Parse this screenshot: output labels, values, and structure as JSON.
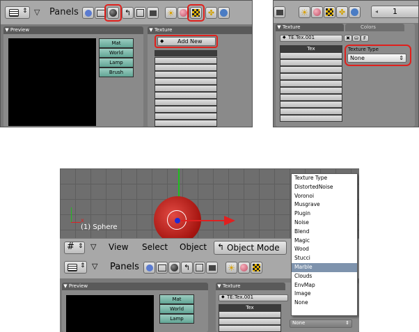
{
  "top_left": {
    "header": {
      "panels_label": "Panels"
    },
    "preview_title": "Preview",
    "texture_title": "Texture",
    "tex_buttons": [
      "Mat",
      "World",
      "Lamp",
      "Brush"
    ],
    "add_new_label": "Add New"
  },
  "top_right": {
    "tabs": [
      "Texture",
      "Colors"
    ],
    "tex_name": "TE:Tex.001",
    "tex_column": "Tex",
    "texture_type_label": "Texture Type",
    "texture_type_value": "None",
    "frame_value": "1"
  },
  "bottom": {
    "viewport_label": "(1) Sphere",
    "view_menu": [
      "View",
      "Select",
      "Object"
    ],
    "mode_label": "Object Mode",
    "panels_label": "Panels",
    "preview_title": "Preview",
    "texture_title": "Texture",
    "tex_buttons": [
      "Mat",
      "World",
      "Lamp"
    ],
    "tex_name": "TE:Tex.001",
    "tex_column": "Tex",
    "dropdown_selected": "None",
    "menu": {
      "title": "Texture Type",
      "items": [
        "DistortedNoise",
        "Voronoi",
        "Musgrave",
        "Plugin",
        "Noise",
        "Blend",
        "Magic",
        "Wood",
        "Stucci",
        "Marble",
        "Clouds",
        "EnvMap",
        "Image",
        "None"
      ],
      "highlighted": "Marble"
    }
  },
  "colors": {
    "highlight": "#e0201c",
    "menu_sel": "#7e93ad",
    "tex_btn": "#62a595",
    "sphere": "#c41a14"
  }
}
